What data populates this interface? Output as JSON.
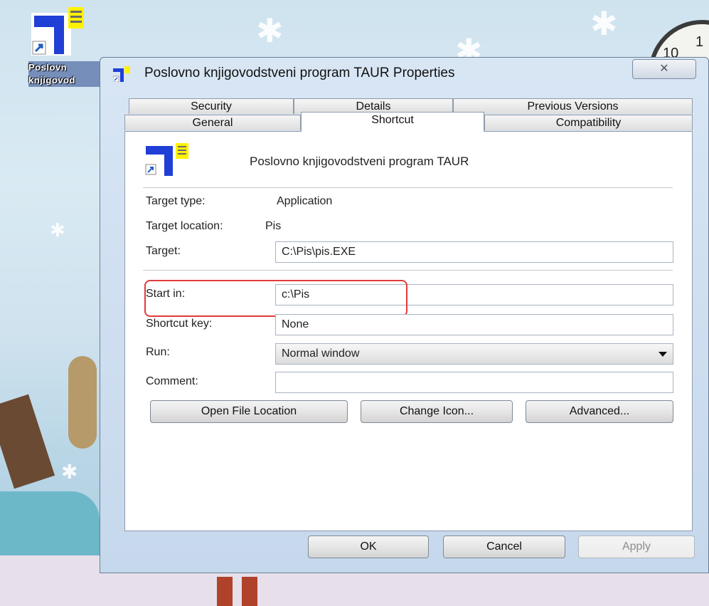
{
  "desktop": {
    "icon_label_line1": "Poslovn",
    "icon_label_line2": "knjigovod",
    "clock_digit_a": "10",
    "clock_digit_b": "1"
  },
  "window": {
    "title": "Poslovno knjigovodstveni program TAUR Properties",
    "close_symbol": "✕"
  },
  "tabs": {
    "row_back": [
      "Security",
      "Details",
      "Previous Versions"
    ],
    "row_front": [
      "General",
      "Shortcut",
      "Compatibility"
    ],
    "active": "Shortcut"
  },
  "shortcut": {
    "app_name": "Poslovno knjigovodstveni program TAUR",
    "target_type_label": "Target type:",
    "target_type_value": "Application",
    "target_location_label": "Target location:",
    "target_location_value": "Pis",
    "target_label": "Target:",
    "target_value": "C:\\Pis\\pis.EXE",
    "start_in_label": "Start in:",
    "start_in_value": "c:\\Pis",
    "shortcut_key_label": "Shortcut key:",
    "shortcut_key_value": "None",
    "run_label": "Run:",
    "run_value": "Normal window",
    "comment_label": "Comment:",
    "comment_value": "",
    "open_file_location": "Open File Location",
    "change_icon": "Change Icon...",
    "advanced": "Advanced..."
  },
  "footer": {
    "ok": "OK",
    "cancel": "Cancel",
    "apply": "Apply"
  },
  "colors": {
    "highlight_border": "#e23a3a",
    "window_frame": "#c9dbee",
    "icon_blue": "#1f3fd6",
    "icon_yellow": "#fff200"
  }
}
